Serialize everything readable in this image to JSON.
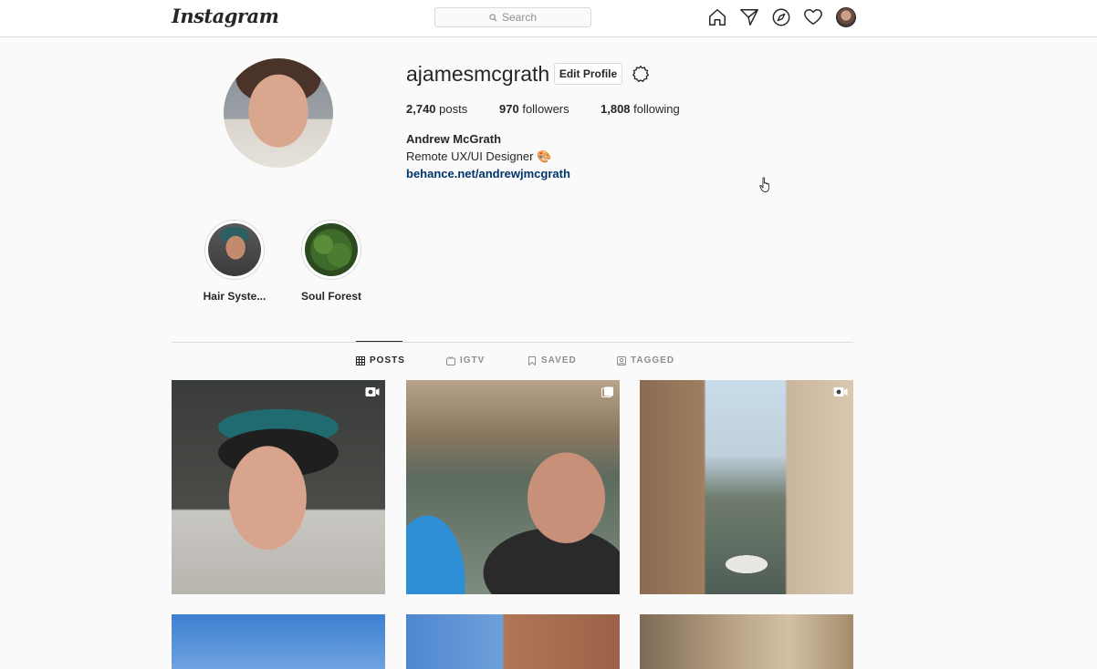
{
  "nav": {
    "logo": "Instagram",
    "search_placeholder": "Search"
  },
  "profile": {
    "username": "ajamesmcgrath",
    "edit_label": "Edit Profile",
    "posts_count": "2,740",
    "posts_label": "posts",
    "followers_count": "970",
    "followers_label": "followers",
    "following_count": "1,808",
    "following_label": "following",
    "full_name": "Andrew McGrath",
    "bio": "Remote UX/UI Designer 🎨",
    "link": "behance.net/andrewjmcgrath"
  },
  "highlights": [
    {
      "label": "Hair Syste..."
    },
    {
      "label": "Soul Forest"
    }
  ],
  "tabs": [
    {
      "label": "POSTS",
      "active": true
    },
    {
      "label": "IGTV",
      "active": false
    },
    {
      "label": "SAVED",
      "active": false
    },
    {
      "label": "TAGGED",
      "active": false
    }
  ],
  "posts": [
    {
      "badge": "video"
    },
    {
      "badge": "carousel"
    },
    {
      "badge": "video"
    },
    {
      "badge": "none"
    },
    {
      "badge": "none"
    },
    {
      "badge": "none"
    }
  ],
  "colors": {
    "text": "#262626",
    "muted": "#8e8e8e",
    "border": "#dbdbdb",
    "link": "#003569",
    "background": "#fafafa"
  }
}
